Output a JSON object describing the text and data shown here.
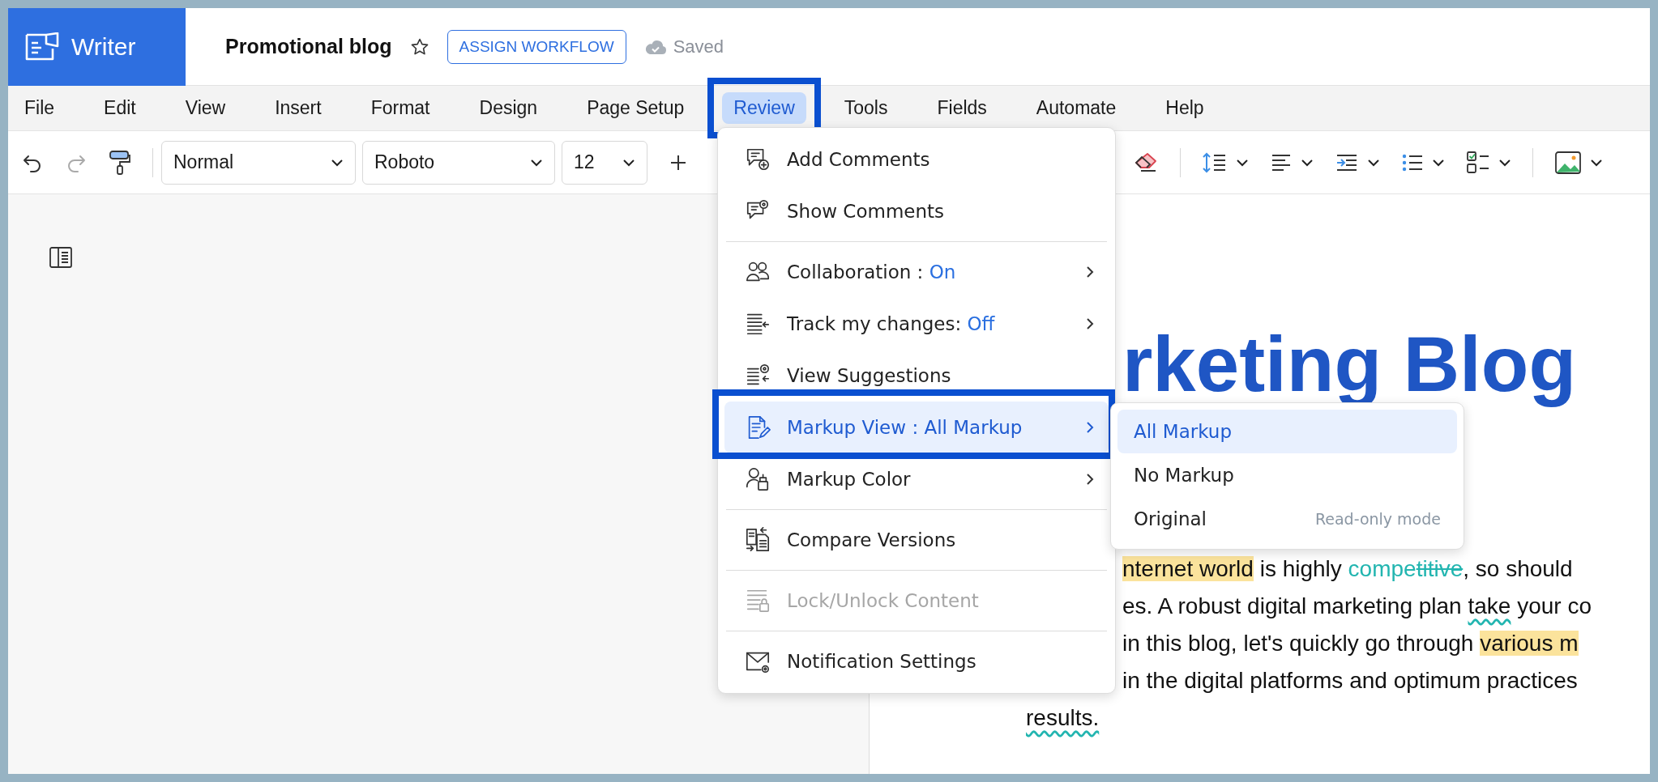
{
  "app": {
    "name": "Writer"
  },
  "document": {
    "title": "Promotional blog",
    "starred": false
  },
  "workflow_button": "ASSIGN WORKFLOW",
  "save_status": "Saved",
  "menu_bar": [
    {
      "label": "File",
      "selected": false
    },
    {
      "label": "Edit",
      "selected": false
    },
    {
      "label": "View",
      "selected": false
    },
    {
      "label": "Insert",
      "selected": false
    },
    {
      "label": "Format",
      "selected": false
    },
    {
      "label": "Design",
      "selected": false
    },
    {
      "label": "Page Setup",
      "selected": false
    },
    {
      "label": "Review",
      "selected": true
    },
    {
      "label": "Tools",
      "selected": false
    },
    {
      "label": "Fields",
      "selected": false
    },
    {
      "label": "Automate",
      "selected": false
    },
    {
      "label": "Help",
      "selected": false
    }
  ],
  "toolbar": {
    "style": "Normal",
    "font": "Roboto",
    "size": "12"
  },
  "review_menu": {
    "groups": [
      [
        {
          "label": "Add Comments",
          "selected": false,
          "disabled": false,
          "submenu": false
        },
        {
          "label": "Show Comments",
          "selected": false,
          "disabled": false,
          "submenu": false
        }
      ],
      [
        {
          "label": "Collaboration :",
          "value": "On",
          "selected": false,
          "disabled": false,
          "submenu": true
        },
        {
          "label": "Track my changes:",
          "value": "Off",
          "selected": false,
          "disabled": false,
          "submenu": true
        },
        {
          "label": "View Suggestions",
          "selected": false,
          "disabled": false,
          "submenu": false
        },
        {
          "label": "Markup View :",
          "value": "All Markup",
          "selected": true,
          "disabled": false,
          "submenu": true
        },
        {
          "label": "Markup Color",
          "selected": false,
          "disabled": false,
          "submenu": true
        }
      ],
      [
        {
          "label": "Compare Versions",
          "selected": false,
          "disabled": false,
          "submenu": false
        }
      ],
      [
        {
          "label": "Lock/Unlock Content",
          "selected": false,
          "disabled": true,
          "submenu": false
        }
      ],
      [
        {
          "label": "Notification Settings",
          "selected": false,
          "disabled": false,
          "submenu": false
        }
      ]
    ]
  },
  "markup_submenu": [
    {
      "label": "All Markup",
      "selected": true
    },
    {
      "label": "No Markup",
      "selected": false
    },
    {
      "label": "Original",
      "note": "Read-only mode",
      "selected": false
    }
  ],
  "page": {
    "heading": "rketing Blog",
    "lines": [
      [
        {
          "text": "nternet world",
          "kind": "highlight"
        },
        {
          "text": " is highly ",
          "kind": "plain"
        },
        {
          "text": "compe",
          "kind": "insertion"
        },
        {
          "text": "titive",
          "kind": "deletion"
        },
        {
          "text": ", so should",
          "kind": "plain"
        }
      ],
      [
        {
          "text": "es. A robust digital marketing plan ",
          "kind": "plain"
        },
        {
          "text": "take",
          "kind": "spelling"
        },
        {
          "text": " your co",
          "kind": "plain"
        }
      ],
      [
        {
          "text": "in this blog, let's quickly go through ",
          "kind": "plain"
        },
        {
          "text": "various m",
          "kind": "highlight"
        }
      ],
      [
        {
          "text": "in the digital platforms and optimum practices",
          "kind": "plain"
        }
      ],
      [
        {
          "text": "results.",
          "kind": "spelling"
        }
      ]
    ]
  }
}
